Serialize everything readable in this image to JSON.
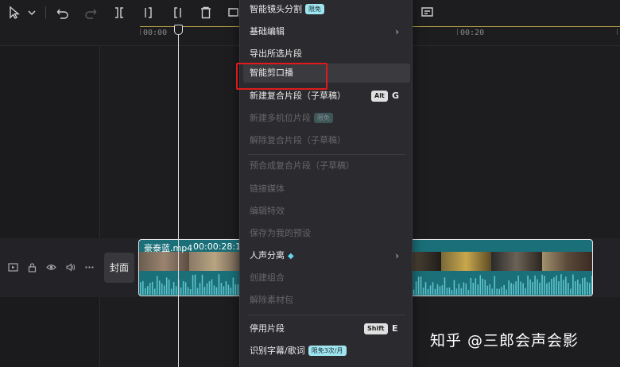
{
  "toolbar": {
    "icons": [
      "cursor-icon",
      "chevron-down-icon",
      "undo-icon",
      "redo-icon",
      "split-icon",
      "split-left-icon",
      "split-right-icon",
      "delete-icon",
      "freeze-icon"
    ]
  },
  "ruler": {
    "start": "00:00",
    "end": "00:20"
  },
  "menu": {
    "items": [
      {
        "label": "智能镜头分割",
        "badge": "限免",
        "disabled": false
      },
      {
        "label": "基础编辑",
        "submenu": true,
        "disabled": false
      },
      {
        "label": "导出所选片段",
        "disabled": false
      },
      {
        "label": "智能剪口播",
        "disabled": false,
        "hover": true
      },
      {
        "label": "新建复合片段（子草稿）",
        "shortcut_mod": "Alt",
        "shortcut_key": "G",
        "disabled": false
      },
      {
        "label": "新建多机位片段",
        "badge": "限免",
        "disabled": true
      },
      {
        "label": "解除复合片段（子草稿）",
        "disabled": true
      },
      {
        "label": "预合成复合片段（子草稿）",
        "disabled": true
      },
      {
        "label": "链接媒体",
        "disabled": true
      },
      {
        "label": "编辑特效",
        "disabled": true
      },
      {
        "label": "保存为我的预设",
        "disabled": true
      },
      {
        "label": "人声分离",
        "submenu": true,
        "disabled": false
      },
      {
        "label": "创建组合",
        "disabled": true
      },
      {
        "label": "解除素材包",
        "disabled": true
      },
      {
        "label": "停用片段",
        "shortcut_mod": "Shift",
        "shortcut_key": "E",
        "disabled": false
      },
      {
        "label": "识别字幕/歌词",
        "badge": "限免3次/月",
        "disabled": false
      }
    ]
  },
  "track": {
    "cover_label": "封面",
    "clip_name": "豪泰蓝.mp4",
    "clip_duration": "00:00:28:11"
  },
  "watermark": "知乎 @三郎会声会影",
  "colors": {
    "clip_bg": "#1a6f78",
    "highlight": "#e01a1a",
    "badge": "#9fe5f0"
  }
}
